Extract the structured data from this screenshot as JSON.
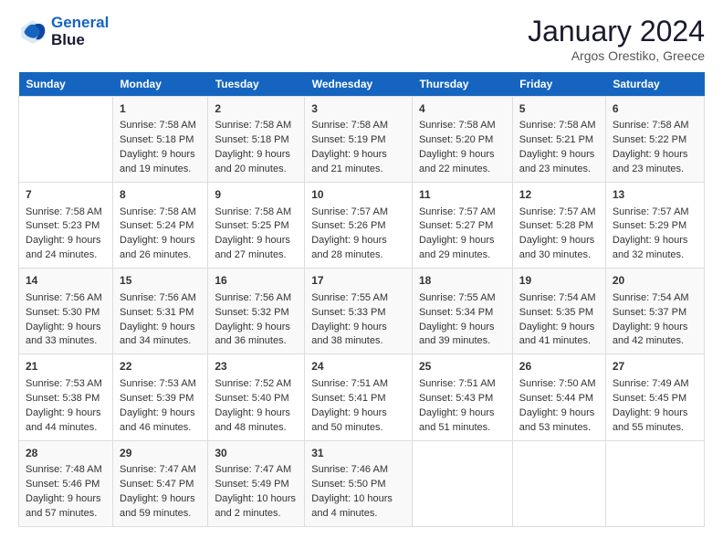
{
  "header": {
    "logo_line1": "General",
    "logo_line2": "Blue",
    "title": "January 2024",
    "subtitle": "Argos Orestiko, Greece"
  },
  "columns": [
    "Sunday",
    "Monday",
    "Tuesday",
    "Wednesday",
    "Thursday",
    "Friday",
    "Saturday"
  ],
  "weeks": [
    [
      {
        "day": "",
        "sunrise": "",
        "sunset": "",
        "daylight": ""
      },
      {
        "day": "1",
        "sunrise": "Sunrise: 7:58 AM",
        "sunset": "Sunset: 5:18 PM",
        "daylight": "Daylight: 9 hours and 19 minutes."
      },
      {
        "day": "2",
        "sunrise": "Sunrise: 7:58 AM",
        "sunset": "Sunset: 5:18 PM",
        "daylight": "Daylight: 9 hours and 20 minutes."
      },
      {
        "day": "3",
        "sunrise": "Sunrise: 7:58 AM",
        "sunset": "Sunset: 5:19 PM",
        "daylight": "Daylight: 9 hours and 21 minutes."
      },
      {
        "day": "4",
        "sunrise": "Sunrise: 7:58 AM",
        "sunset": "Sunset: 5:20 PM",
        "daylight": "Daylight: 9 hours and 22 minutes."
      },
      {
        "day": "5",
        "sunrise": "Sunrise: 7:58 AM",
        "sunset": "Sunset: 5:21 PM",
        "daylight": "Daylight: 9 hours and 23 minutes."
      },
      {
        "day": "6",
        "sunrise": "Sunrise: 7:58 AM",
        "sunset": "Sunset: 5:22 PM",
        "daylight": "Daylight: 9 hours and 23 minutes."
      }
    ],
    [
      {
        "day": "7",
        "sunrise": "Sunrise: 7:58 AM",
        "sunset": "Sunset: 5:23 PM",
        "daylight": "Daylight: 9 hours and 24 minutes."
      },
      {
        "day": "8",
        "sunrise": "Sunrise: 7:58 AM",
        "sunset": "Sunset: 5:24 PM",
        "daylight": "Daylight: 9 hours and 26 minutes."
      },
      {
        "day": "9",
        "sunrise": "Sunrise: 7:58 AM",
        "sunset": "Sunset: 5:25 PM",
        "daylight": "Daylight: 9 hours and 27 minutes."
      },
      {
        "day": "10",
        "sunrise": "Sunrise: 7:57 AM",
        "sunset": "Sunset: 5:26 PM",
        "daylight": "Daylight: 9 hours and 28 minutes."
      },
      {
        "day": "11",
        "sunrise": "Sunrise: 7:57 AM",
        "sunset": "Sunset: 5:27 PM",
        "daylight": "Daylight: 9 hours and 29 minutes."
      },
      {
        "day": "12",
        "sunrise": "Sunrise: 7:57 AM",
        "sunset": "Sunset: 5:28 PM",
        "daylight": "Daylight: 9 hours and 30 minutes."
      },
      {
        "day": "13",
        "sunrise": "Sunrise: 7:57 AM",
        "sunset": "Sunset: 5:29 PM",
        "daylight": "Daylight: 9 hours and 32 minutes."
      }
    ],
    [
      {
        "day": "14",
        "sunrise": "Sunrise: 7:56 AM",
        "sunset": "Sunset: 5:30 PM",
        "daylight": "Daylight: 9 hours and 33 minutes."
      },
      {
        "day": "15",
        "sunrise": "Sunrise: 7:56 AM",
        "sunset": "Sunset: 5:31 PM",
        "daylight": "Daylight: 9 hours and 34 minutes."
      },
      {
        "day": "16",
        "sunrise": "Sunrise: 7:56 AM",
        "sunset": "Sunset: 5:32 PM",
        "daylight": "Daylight: 9 hours and 36 minutes."
      },
      {
        "day": "17",
        "sunrise": "Sunrise: 7:55 AM",
        "sunset": "Sunset: 5:33 PM",
        "daylight": "Daylight: 9 hours and 38 minutes."
      },
      {
        "day": "18",
        "sunrise": "Sunrise: 7:55 AM",
        "sunset": "Sunset: 5:34 PM",
        "daylight": "Daylight: 9 hours and 39 minutes."
      },
      {
        "day": "19",
        "sunrise": "Sunrise: 7:54 AM",
        "sunset": "Sunset: 5:35 PM",
        "daylight": "Daylight: 9 hours and 41 minutes."
      },
      {
        "day": "20",
        "sunrise": "Sunrise: 7:54 AM",
        "sunset": "Sunset: 5:37 PM",
        "daylight": "Daylight: 9 hours and 42 minutes."
      }
    ],
    [
      {
        "day": "21",
        "sunrise": "Sunrise: 7:53 AM",
        "sunset": "Sunset: 5:38 PM",
        "daylight": "Daylight: 9 hours and 44 minutes."
      },
      {
        "day": "22",
        "sunrise": "Sunrise: 7:53 AM",
        "sunset": "Sunset: 5:39 PM",
        "daylight": "Daylight: 9 hours and 46 minutes."
      },
      {
        "day": "23",
        "sunrise": "Sunrise: 7:52 AM",
        "sunset": "Sunset: 5:40 PM",
        "daylight": "Daylight: 9 hours and 48 minutes."
      },
      {
        "day": "24",
        "sunrise": "Sunrise: 7:51 AM",
        "sunset": "Sunset: 5:41 PM",
        "daylight": "Daylight: 9 hours and 50 minutes."
      },
      {
        "day": "25",
        "sunrise": "Sunrise: 7:51 AM",
        "sunset": "Sunset: 5:43 PM",
        "daylight": "Daylight: 9 hours and 51 minutes."
      },
      {
        "day": "26",
        "sunrise": "Sunrise: 7:50 AM",
        "sunset": "Sunset: 5:44 PM",
        "daylight": "Daylight: 9 hours and 53 minutes."
      },
      {
        "day": "27",
        "sunrise": "Sunrise: 7:49 AM",
        "sunset": "Sunset: 5:45 PM",
        "daylight": "Daylight: 9 hours and 55 minutes."
      }
    ],
    [
      {
        "day": "28",
        "sunrise": "Sunrise: 7:48 AM",
        "sunset": "Sunset: 5:46 PM",
        "daylight": "Daylight: 9 hours and 57 minutes."
      },
      {
        "day": "29",
        "sunrise": "Sunrise: 7:47 AM",
        "sunset": "Sunset: 5:47 PM",
        "daylight": "Daylight: 9 hours and 59 minutes."
      },
      {
        "day": "30",
        "sunrise": "Sunrise: 7:47 AM",
        "sunset": "Sunset: 5:49 PM",
        "daylight": "Daylight: 10 hours and 2 minutes."
      },
      {
        "day": "31",
        "sunrise": "Sunrise: 7:46 AM",
        "sunset": "Sunset: 5:50 PM",
        "daylight": "Daylight: 10 hours and 4 minutes."
      },
      {
        "day": "",
        "sunrise": "",
        "sunset": "",
        "daylight": ""
      },
      {
        "day": "",
        "sunrise": "",
        "sunset": "",
        "daylight": ""
      },
      {
        "day": "",
        "sunrise": "",
        "sunset": "",
        "daylight": ""
      }
    ]
  ]
}
